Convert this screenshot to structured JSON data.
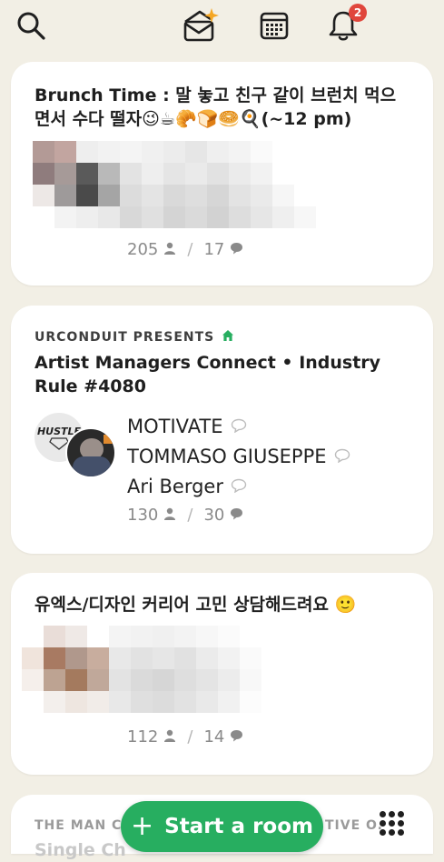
{
  "header": {
    "notification_count": "2"
  },
  "rooms": [
    {
      "title": "Brunch Time : 말 놓고 친구 같이 브런치 먹으면서 수다 떨자😉☕🥐🍞🥯🍳(~12 pm)",
      "listeners": "205",
      "speakers_count": "17"
    },
    {
      "club": "URCONDUIT PRESENTS",
      "title": "Artist Managers Connect • Industry Rule #4080",
      "avatar_text": "HUSTLE",
      "speakers": [
        "MOTIVATE",
        "TOMMASO GIUSEPPE",
        "Ari Berger"
      ],
      "listeners": "130",
      "speakers_count": "30"
    },
    {
      "title": "유엑스/디자인 커리어 고민 상담해드려요 🙂",
      "listeners": "112",
      "speakers_count": "14"
    },
    {
      "club_partial": "THE MAN C",
      "club_partial_end": "TIVE O.",
      "title_partial": "Single Ch"
    }
  ],
  "fab": {
    "label": "Start a room"
  },
  "colors": {
    "accent": "#27ae60",
    "background": "#f2efe5",
    "badge": "#e0463c"
  }
}
